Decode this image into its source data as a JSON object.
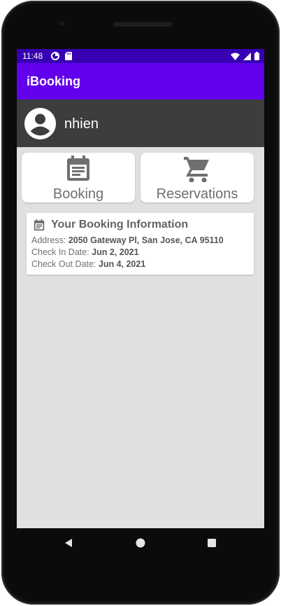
{
  "status_bar": {
    "time": "11:48",
    "icons": [
      "data-saver-icon",
      "sd-card-icon",
      "wifi-icon",
      "signal-icon",
      "battery-icon"
    ]
  },
  "app_bar": {
    "title": "iBooking"
  },
  "user": {
    "name": "nhien",
    "avatar_icon": "account-circle-icon"
  },
  "actions": [
    {
      "label": "Booking",
      "icon": "calendar-icon"
    },
    {
      "label": "Reservations",
      "icon": "cart-icon"
    }
  ],
  "booking_info": {
    "title": "Your Booking Information",
    "icon": "calendar-icon",
    "address_label": "Address:",
    "address_value": "2050 Gateway Pl, San Jose, CA 95110",
    "check_in_label": "Check In Date:",
    "check_in_value": "Jun 2, 2021",
    "check_out_label": "Check Out Date:",
    "check_out_value": "Jun 4, 2021"
  },
  "nav_bar": {
    "buttons": [
      "back-icon",
      "home-icon",
      "recents-icon"
    ]
  },
  "colors": {
    "status_bar": "#3700b3",
    "app_bar": "#6200ee",
    "user_bar": "#3d3d3d",
    "background": "#e0e0e0",
    "tile": "#ffffff",
    "icon_gray": "#6f6f6f"
  }
}
